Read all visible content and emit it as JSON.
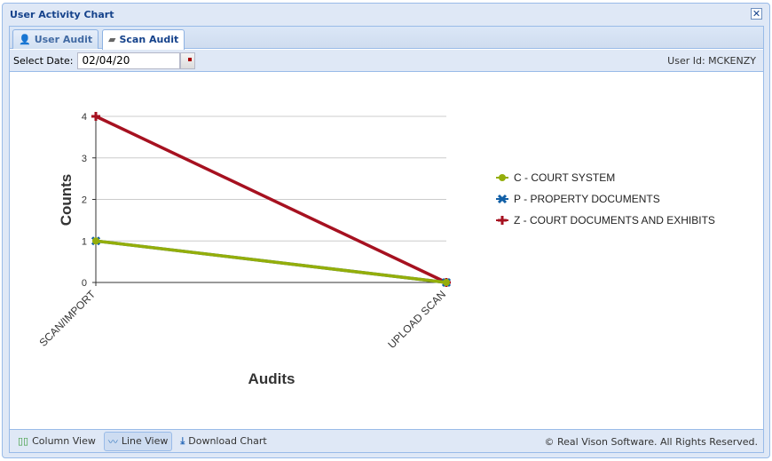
{
  "window": {
    "title": "User Activity Chart"
  },
  "tabs": [
    {
      "label": "User Audit",
      "icon": "user-icon"
    },
    {
      "label": "Scan Audit",
      "icon": "scanner-icon",
      "active": true
    }
  ],
  "toolbar": {
    "date_label": "Select Date:",
    "date_value": "02/04/20",
    "user_id": "User Id: MCKENZY"
  },
  "footer": {
    "column_view": "Column View",
    "line_view": "Line View",
    "download": "Download Chart",
    "copyright": "© Real Vison Software. All Rights Reserved."
  },
  "chart_data": {
    "type": "line",
    "categories": [
      "SCAN/IMPORT",
      "UPLOAD SCAN"
    ],
    "xlabel": "Audits",
    "ylabel": "Counts",
    "ylim": [
      0,
      4
    ],
    "yticks": [
      "0",
      "1",
      "2",
      "3",
      "4"
    ],
    "grid": true,
    "legend_position": "right",
    "series": [
      {
        "name": "C - COURT SYSTEM",
        "values": [
          1,
          0
        ],
        "color": "#94ae0a",
        "marker": "circle"
      },
      {
        "name": "P - PROPERTY DOCUMENTS",
        "values": [
          1,
          0
        ],
        "color": "#115fa6",
        "marker": "cross"
      },
      {
        "name": "Z - COURT DOCUMENTS AND EXHIBITS",
        "values": [
          4,
          0
        ],
        "color": "#a61120",
        "marker": "plus"
      }
    ]
  }
}
